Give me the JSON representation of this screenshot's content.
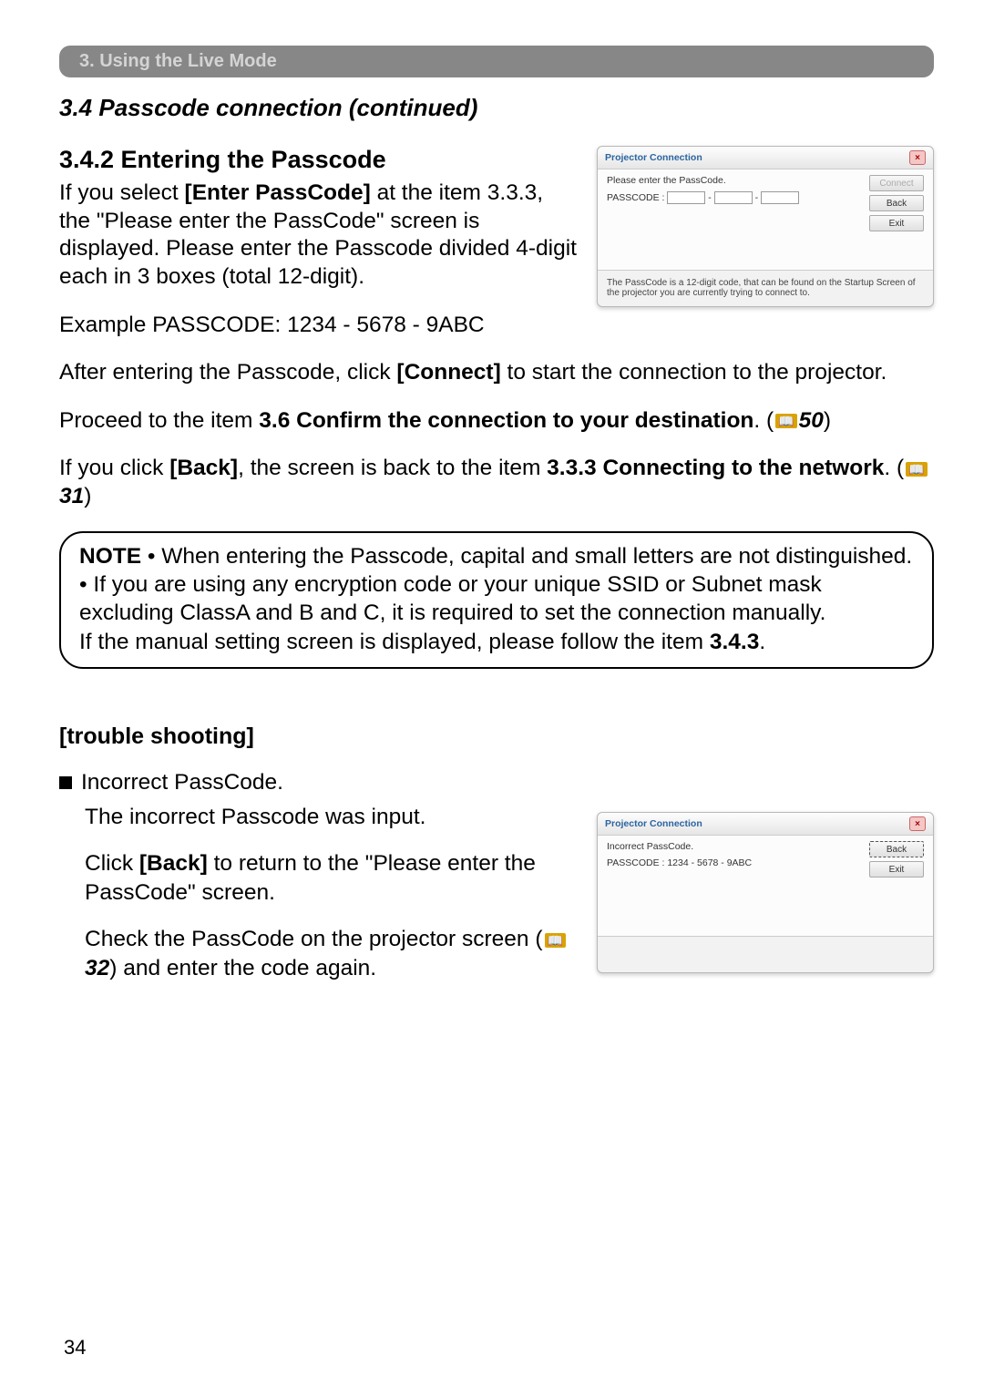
{
  "chapter_bar": "3. Using the Live Mode",
  "section_title": "3.4 Passcode connection (continued)",
  "subheading": "3.4.2 Entering the Passcode",
  "p_intro_1": "If you select ",
  "p_intro_bold1": "[Enter PassCode]",
  "p_intro_2": " at the item 3.3.3, the \"Please enter the PassCode\" screen is displayed. Please enter the Passcode divided 4-digit each in 3 boxes (total 12-digit).",
  "p_example": "Example PASSCODE: 1234 - 5678 - 9ABC",
  "p_after_1": "After entering the Passcode, click ",
  "p_after_b": "[Connect]",
  "p_after_2": " to start the connection to the projector.",
  "p_proceed_1": "Proceed to the item ",
  "p_proceed_b": "3.6 Confirm the connection to your destination",
  "p_proceed_2": ". (",
  "p_proceed_ref": "50",
  "p_proceed_3": ")",
  "p_back_1": "If you click ",
  "p_back_b1": "[Back]",
  "p_back_2": ", the screen is back to the item ",
  "p_back_b2": "3.3.3 Connecting to the network",
  "p_back_3": ". (",
  "p_back_ref": "31",
  "p_back_4": ")",
  "note_label": "NOTE",
  "note_l1": " • When entering the Passcode, capital and small letters are not distinguished.",
  "note_l2": "• If you are using any encryption code or your unique SSID or Subnet mask excluding ClassA and B and C, it is required to set the connection manually.",
  "note_l3": "If the manual setting screen is displayed, please follow the item ",
  "note_l3_b": "3.4.3",
  "note_l3_end": ".",
  "ts_head": "[trouble shooting]",
  "ts_bullet": "Incorrect PassCode.",
  "ts_p1": "The incorrect Passcode was input.",
  "ts_p2_1": "Click ",
  "ts_p2_b": "[Back]",
  "ts_p2_2": " to return to the \"Please enter the PassCode\" screen.",
  "ts_p3_1": "Check the PassCode on the projector screen (",
  "ts_p3_ref": "32",
  "ts_p3_2": ") and enter the code again.",
  "page_num": "34",
  "dialog1": {
    "title": "Projector Connection",
    "msg": "Please enter the PassCode.",
    "label": "PASSCODE :",
    "btn_connect": "Connect",
    "btn_back": "Back",
    "btn_exit": "Exit",
    "footer": "The PassCode is a 12-digit code, that can be found on the Startup Screen of the projector you are currently trying to connect to."
  },
  "dialog2": {
    "title": "Projector Connection",
    "msg": "Incorrect PassCode.",
    "value": "PASSCODE : 1234 - 5678 - 9ABC",
    "btn_back": "Back",
    "btn_exit": "Exit"
  }
}
